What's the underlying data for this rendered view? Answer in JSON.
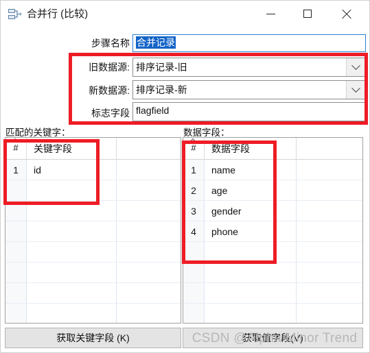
{
  "window": {
    "title": "合并行 (比较)",
    "icon": "merge-rows-icon",
    "minimize_label": "─",
    "maximize_label": "□",
    "close_label": "✕"
  },
  "form": {
    "step_name": {
      "label": "步骤名称",
      "value": "合并记录",
      "selected": true
    },
    "old_source": {
      "label": "旧数据源:",
      "value": "排序记录-旧"
    },
    "new_source": {
      "label": "新数据源:",
      "value": "排序记录-新"
    },
    "flag_field": {
      "label": "标志字段",
      "value": "flagfield"
    }
  },
  "panels": {
    "keys": {
      "label": "匹配的关键字：",
      "columns": [
        "#",
        "关键字段"
      ],
      "rows": [
        [
          "1",
          "id"
        ]
      ],
      "empty_rows": 7,
      "button_label": "获取关键字段 (K)"
    },
    "fields": {
      "label": "数据字段：",
      "columns": [
        "#",
        "数据字段"
      ],
      "rows": [
        [
          "1",
          "name"
        ],
        [
          "2",
          "age"
        ],
        [
          "3",
          "gender"
        ],
        [
          "4",
          "phone"
        ]
      ],
      "empty_rows": 4,
      "button_label": "获取值字段(V)"
    }
  },
  "watermark": {
    "text": "CSDN @Alpha Minor Trend"
  },
  "colors": {
    "annotation_red": "#ee1c25",
    "selection_blue": "#1464c8",
    "focus_border": "#2a7fd4"
  }
}
